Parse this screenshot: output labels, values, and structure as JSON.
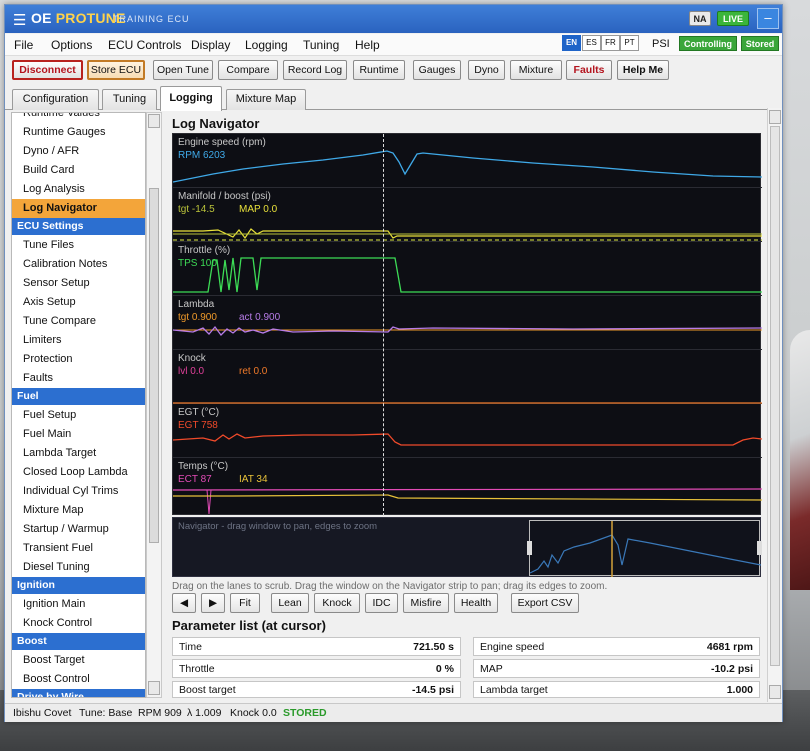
{
  "titlebar": {
    "brand_a": "OE ",
    "brand_b": "PROTUNE",
    "subtitle": "TRAINING ECU",
    "na": "NA",
    "live": "LIVE",
    "min": "–"
  },
  "menu": [
    "File",
    "Options",
    "ECU Controls",
    "Display",
    "Logging",
    "Tuning",
    "Help"
  ],
  "languages": [
    "EN",
    "ES",
    "FR",
    "PT"
  ],
  "active_language": "EN",
  "units": "PSI",
  "badges": {
    "controlling": "Controlling",
    "stored": "Stored"
  },
  "toolbar": [
    "Disconnect",
    "Store ECU",
    "Open Tune",
    "Compare",
    "Record Log",
    "Runtime",
    "Gauges",
    "Dyno",
    "Mixture",
    "Faults",
    "Help Me"
  ],
  "tabs": [
    "Configuration",
    "Tuning",
    "Logging",
    "Mixture Map"
  ],
  "active_tab": "Logging",
  "sidebar": {
    "items": [
      {
        "type": "item",
        "label": "Runtime Values"
      },
      {
        "type": "item",
        "label": "Runtime Gauges"
      },
      {
        "type": "item",
        "label": "Dyno / AFR"
      },
      {
        "type": "item",
        "label": "Build Card"
      },
      {
        "type": "item",
        "label": "Log Analysis"
      },
      {
        "type": "item",
        "label": "Log Navigator",
        "selected": true
      },
      {
        "type": "head",
        "label": "ECU Settings"
      },
      {
        "type": "item",
        "label": "Tune Files"
      },
      {
        "type": "item",
        "label": "Calibration Notes"
      },
      {
        "type": "item",
        "label": "Sensor Setup"
      },
      {
        "type": "item",
        "label": "Axis Setup"
      },
      {
        "type": "item",
        "label": "Tune Compare"
      },
      {
        "type": "item",
        "label": "Limiters"
      },
      {
        "type": "item",
        "label": "Protection"
      },
      {
        "type": "item",
        "label": "Faults"
      },
      {
        "type": "head",
        "label": "Fuel"
      },
      {
        "type": "item",
        "label": "Fuel Setup"
      },
      {
        "type": "item",
        "label": "Fuel Main"
      },
      {
        "type": "item",
        "label": "Lambda Target"
      },
      {
        "type": "item",
        "label": "Closed Loop Lambda"
      },
      {
        "type": "item",
        "label": "Individual Cyl Trims"
      },
      {
        "type": "item",
        "label": "Mixture Map"
      },
      {
        "type": "item",
        "label": "Startup / Warmup"
      },
      {
        "type": "item",
        "label": "Transient Fuel"
      },
      {
        "type": "item",
        "label": "Diesel Tuning"
      },
      {
        "type": "head",
        "label": "Ignition"
      },
      {
        "type": "item",
        "label": "Ignition Main"
      },
      {
        "type": "item",
        "label": "Knock Control"
      },
      {
        "type": "head",
        "label": "Boost"
      },
      {
        "type": "item",
        "label": "Boost Target"
      },
      {
        "type": "item",
        "label": "Boost Control"
      },
      {
        "type": "head",
        "label": "Drive by Wire"
      }
    ]
  },
  "panel_title": "Log Navigator",
  "lanes": [
    {
      "name": "Engine speed (rpm)",
      "values": [
        {
          "text": "RPM 6203",
          "color": "#3fa9e8"
        }
      ]
    },
    {
      "name": "Manifold / boost (psi)",
      "values": [
        {
          "text": "tgt -14.5",
          "color": "#b9c23a"
        },
        {
          "text": "MAP 0.0",
          "color": "#e8e03a"
        }
      ]
    },
    {
      "name": "Throttle (%)",
      "values": [
        {
          "text": "TPS 100",
          "color": "#3ddc56"
        }
      ]
    },
    {
      "name": "Lambda",
      "values": [
        {
          "text": "tgt 0.900",
          "color": "#f09a2a"
        },
        {
          "text": "act 0.900",
          "color": "#b77ce8"
        }
      ]
    },
    {
      "name": "Knock",
      "values": [
        {
          "text": "lvl 0.0",
          "color": "#e0409a"
        },
        {
          "text": "ret 0.0",
          "color": "#f07a2a"
        }
      ]
    },
    {
      "name": "EGT (°C)",
      "values": [
        {
          "text": "EGT 758",
          "color": "#f04a2a"
        }
      ]
    },
    {
      "name": "Temps (°C)",
      "values": [
        {
          "text": "ECT 87",
          "color": "#e24bb6"
        },
        {
          "text": "IAT 34",
          "color": "#e8c23a"
        }
      ]
    }
  ],
  "navigator_hint": "Navigator - drag window to pan, edges to zoom",
  "scrub_hint": "Drag on the lanes to scrub. Drag the window on the Navigator strip to pan; drag its edges to zoom.",
  "controls": [
    "◀",
    "▶",
    "Fit",
    "Lean",
    "Knock",
    "IDC",
    "Misfire",
    "Health",
    "Export CSV"
  ],
  "param_title": "Parameter list (at cursor)",
  "params": [
    {
      "k": "Time",
      "v": "721.50 s"
    },
    {
      "k": "Engine speed",
      "v": "4681 rpm"
    },
    {
      "k": "Throttle",
      "v": "0 %"
    },
    {
      "k": "MAP",
      "v": "-10.2 psi"
    },
    {
      "k": "Boost target",
      "v": "-14.5 psi"
    },
    {
      "k": "Lambda target",
      "v": "1.000"
    }
  ],
  "status": {
    "car": "Ibishu Covet",
    "tune": "Tune: Base",
    "rpm": "RPM 909",
    "lambda": "λ 1.009",
    "knock": "Knock 0.0",
    "state": "STORED"
  }
}
